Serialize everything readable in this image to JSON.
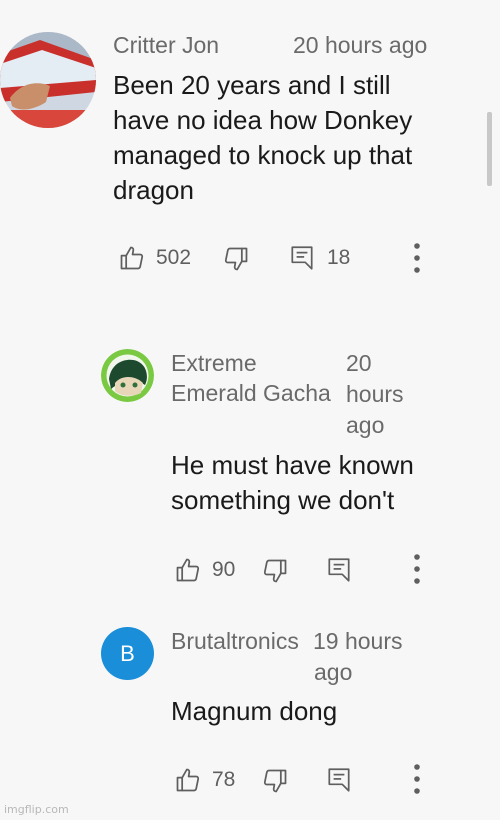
{
  "comments": [
    {
      "author": "Critter Jon",
      "time": "20 hours ago",
      "text_lines": [
        "Been 20 years and I still",
        "have no idea how Donkey",
        "managed to knock up that",
        "dragon"
      ],
      "likes": "502",
      "replies": "18"
    },
    {
      "author_lines": [
        "Extreme",
        "Emerald Gacha"
      ],
      "time_lines": [
        "20",
        "hours",
        "ago"
      ],
      "text_lines": [
        "He must have known",
        "something we don't"
      ],
      "likes": "90"
    },
    {
      "author": "Brutaltronics",
      "time_lines": [
        "19 hours",
        "ago"
      ],
      "avatar_letter": "B",
      "text_lines": [
        "Magnum dong"
      ],
      "likes": "78"
    }
  ],
  "watermark": "imgflip.com",
  "colors": {
    "background": "#f7f7f7",
    "meta_text": "#6a6a6a",
    "body_text": "#1a1a1a",
    "avatar_blue": "#1a8ed8"
  }
}
